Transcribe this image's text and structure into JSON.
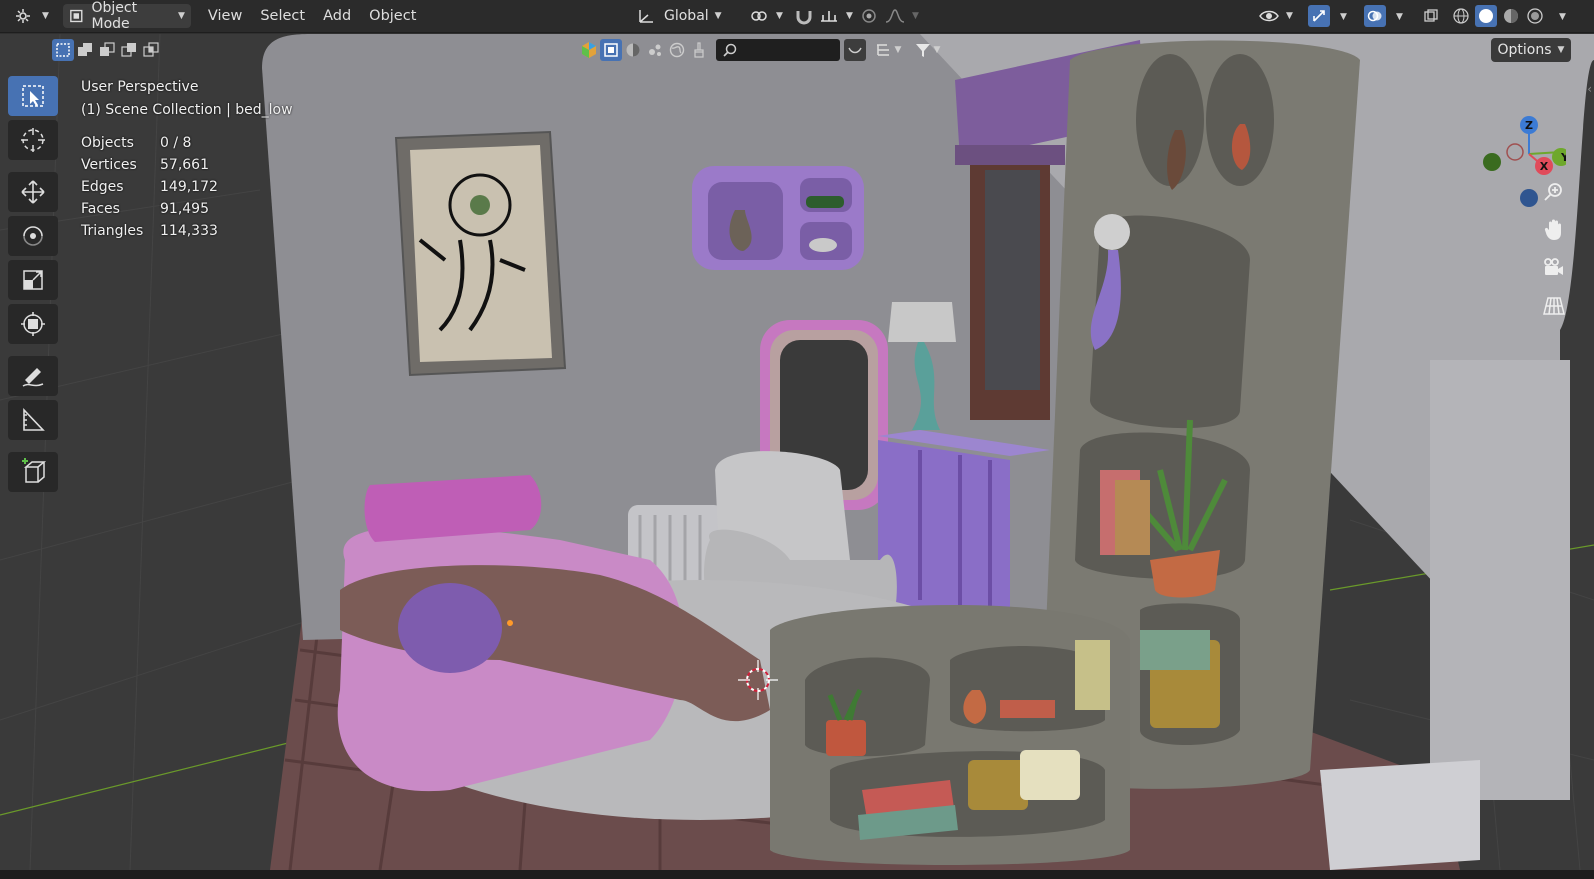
{
  "header": {
    "mode_label": "Object Mode",
    "menu": [
      "View",
      "Select",
      "Add",
      "Object"
    ],
    "transform_orientation": "Global",
    "editor_type_icon": "editor-type-icon"
  },
  "subbar": {
    "search_placeholder": "",
    "options_label": "Options"
  },
  "viewport": {
    "perspective": "User Perspective",
    "collection": "(1) Scene Collection | bed_low",
    "stats": [
      {
        "key": "Objects",
        "value": "0 / 8"
      },
      {
        "key": "Vertices",
        "value": "57,661"
      },
      {
        "key": "Edges",
        "value": "149,172"
      },
      {
        "key": "Faces",
        "value": "91,495"
      },
      {
        "key": "Triangles",
        "value": "114,333"
      }
    ]
  },
  "gizmo": {
    "z_label": "Z",
    "y_label": "Y",
    "x_label": "X"
  },
  "colors": {
    "accent": "#4772b3",
    "axis_x": "#e04b5a",
    "axis_y": "#6ea82c",
    "axis_z": "#3c7bd4"
  }
}
